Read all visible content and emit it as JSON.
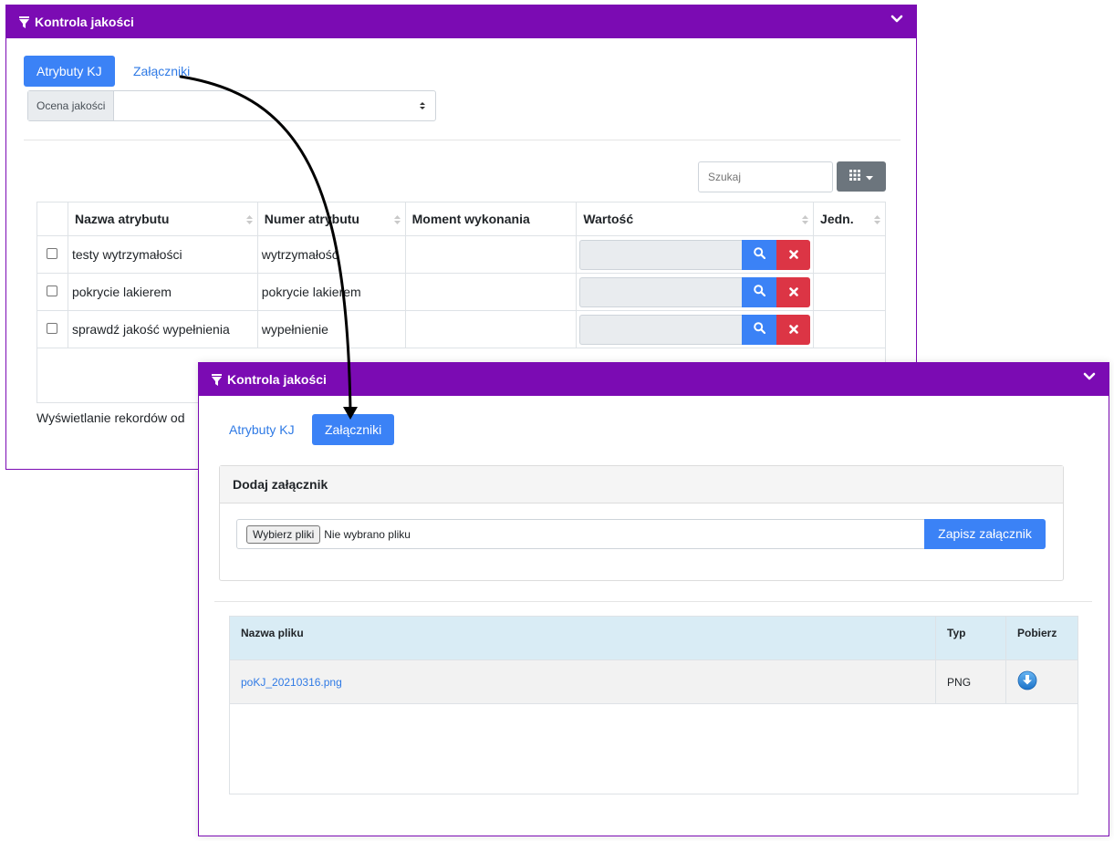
{
  "panel1": {
    "title": "Kontrola jakości",
    "tabs": {
      "attributes": "Atrybuty KJ",
      "attachments": "Załączniki"
    },
    "quality_select": {
      "label": "Ocena jakości",
      "value": ""
    },
    "search": {
      "placeholder": "Szukaj"
    },
    "table": {
      "headers": [
        "Nazwa atrybutu",
        "Numer atrybutu",
        "Moment wykonania",
        "Wartość",
        "Jedn."
      ],
      "rows": [
        {
          "name": "testy wytrzymałości",
          "number": "wytrzymałość",
          "moment": "",
          "value": "",
          "unit": ""
        },
        {
          "name": "pokrycie lakierem",
          "number": "pokrycie lakierem",
          "moment": "",
          "value": "",
          "unit": ""
        },
        {
          "name": "sprawdź jakość wypełnienia",
          "number": "wypełnienie",
          "moment": "",
          "value": "",
          "unit": ""
        }
      ]
    },
    "records_text": "Wyświetlanie rekordów od"
  },
  "panel2": {
    "title": "Kontrola jakości",
    "tabs": {
      "attributes": "Atrybuty KJ",
      "attachments": "Załączniki"
    },
    "add_attachment": {
      "title": "Dodaj załącznik",
      "choose_button": "Wybierz pliki",
      "no_file": "Nie wybrano pliku",
      "save_button": "Zapisz załącznik"
    },
    "table": {
      "headers": [
        "Nazwa pliku",
        "Typ",
        "Pobierz"
      ],
      "rows": [
        {
          "file": "poKJ_20210316.png",
          "type": "PNG"
        }
      ]
    }
  },
  "colors": {
    "header_purple": "#7b0bb3",
    "primary_blue": "#3b82f6",
    "danger_red": "#dc3545",
    "grey_button": "#6c757d"
  }
}
